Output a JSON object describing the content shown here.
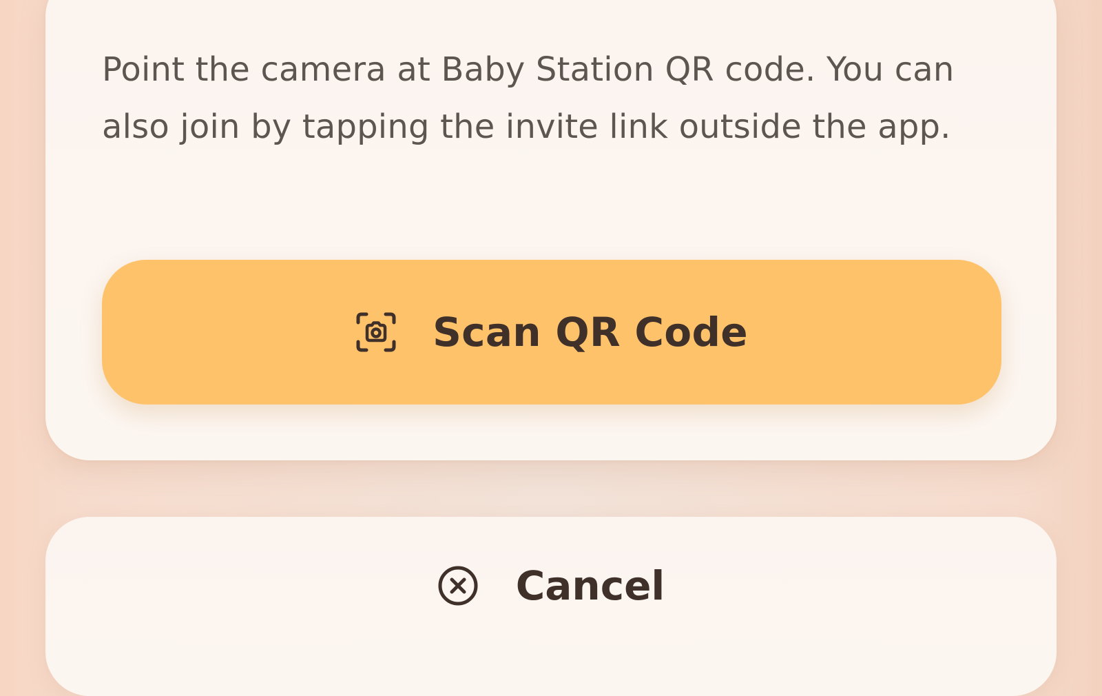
{
  "dialog": {
    "description": "Point the camera at Baby Station QR code. You can also join by tapping the invite link outside the app.",
    "scan_button": {
      "label": "Scan QR Code",
      "icon": "camera-scan-icon",
      "color": "#fec26b"
    },
    "cancel_button": {
      "label": "Cancel",
      "icon": "close-circle-icon"
    }
  },
  "colors": {
    "text_primary": "#3f302a",
    "text_secondary": "#5d5550",
    "card_background": "#fbf4ef",
    "accent": "#fec26b"
  }
}
